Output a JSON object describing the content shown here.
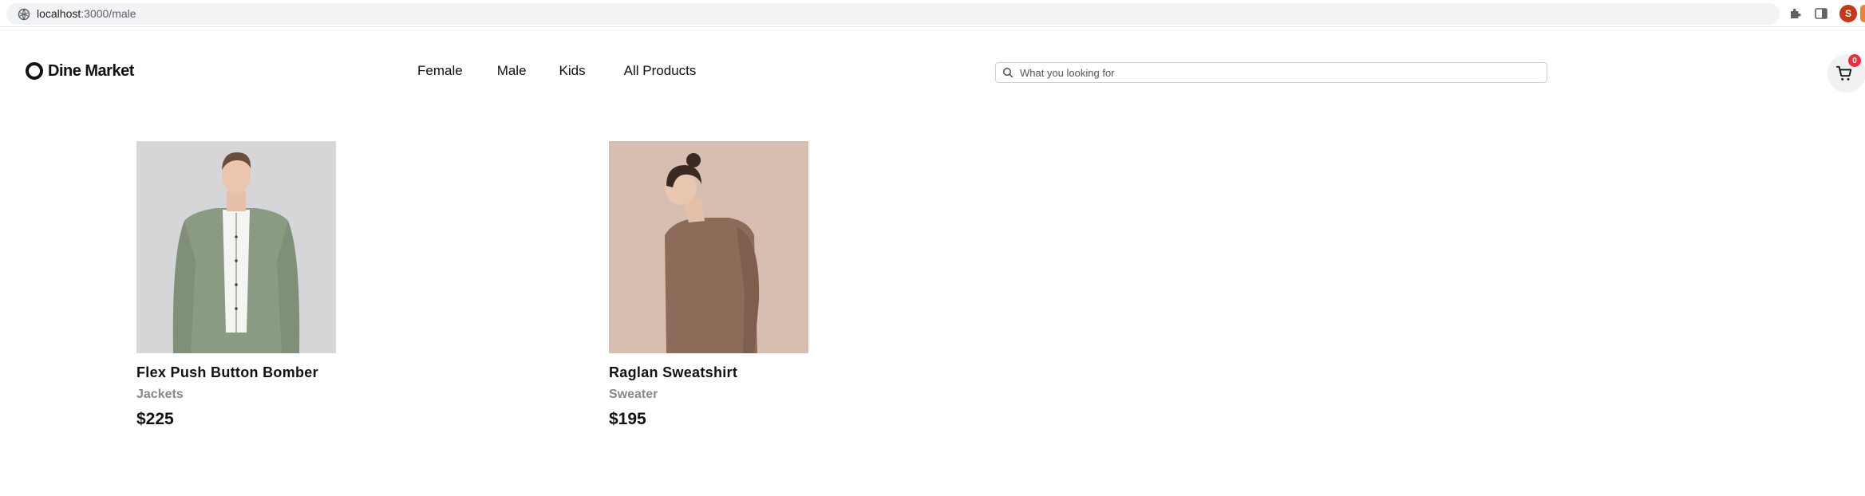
{
  "browser": {
    "url_host": "localhost",
    "url_path": ":3000/male",
    "profile_initial": "S",
    "icons": [
      "site-info-icon",
      "extensions-icon",
      "side-panel-icon"
    ]
  },
  "header": {
    "logo_text": "Dine Market",
    "nav": [
      {
        "label": "Female"
      },
      {
        "label": "Male"
      },
      {
        "label": "Kids"
      },
      {
        "label": "All Products"
      }
    ],
    "search_placeholder": "What you looking for",
    "cart_count": "0"
  },
  "products": [
    {
      "title": "Flex Push Button Bomber",
      "category": "Jackets",
      "price": "$225"
    },
    {
      "title": "Raglan Sweatshirt",
      "category": "Sweater",
      "price": "$195"
    }
  ],
  "colors": {
    "accent_badge": "#f02d3a",
    "category_text": "#888888",
    "jacket_bg": "#d6d6d8",
    "jacket": "#8b9b83",
    "sweater_bg": "#d6bfb0",
    "sweater": "#8c6b58"
  }
}
